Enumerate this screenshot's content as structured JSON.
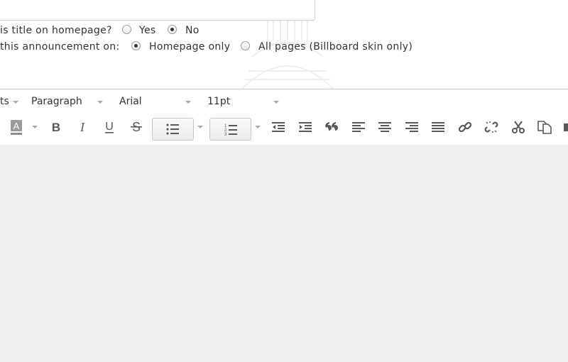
{
  "form": {
    "show_title_label": "is title on homepage?",
    "show_title_options": [
      {
        "label": "Yes",
        "checked": false
      },
      {
        "label": "No",
        "checked": true
      }
    ],
    "display_label": "this announcement on:",
    "display_options": [
      {
        "label": "Homepage only",
        "checked": true
      },
      {
        "label": "All pages (Billboard skin only)",
        "checked": false
      }
    ]
  },
  "toolbar": {
    "formats_label": "ts",
    "block_format": "Paragraph",
    "font_family": "Arial",
    "font_size": "11pt",
    "buttons": [
      "text-color",
      "bold",
      "italic",
      "underline",
      "strikethrough",
      "bullet-list",
      "numbered-list",
      "outdent",
      "indent",
      "blockquote",
      "align-left",
      "align-center",
      "align-right",
      "justify",
      "insert-link",
      "remove-link",
      "cut",
      "copy"
    ]
  },
  "colors": {
    "text_color_bar": "#8c8c8c",
    "content_bg": "#efefef",
    "icon": "#595959"
  }
}
